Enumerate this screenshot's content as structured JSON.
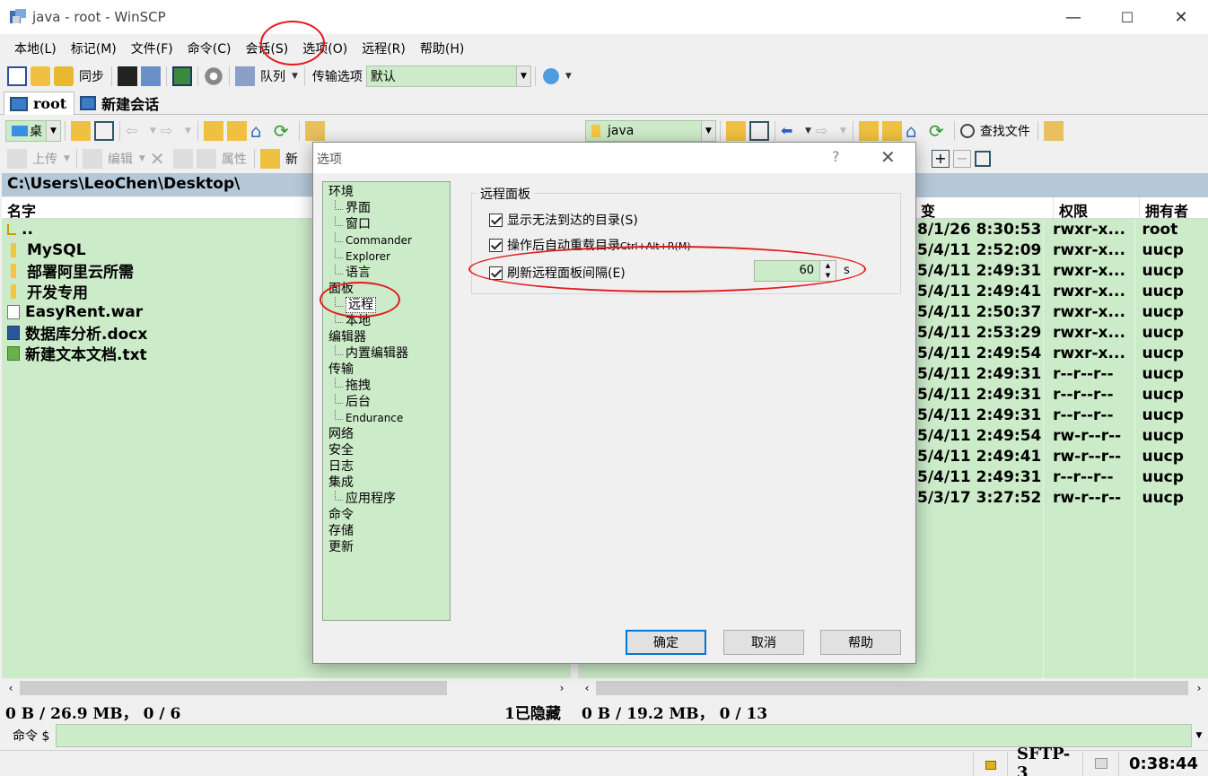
{
  "window": {
    "title": "java - root - WinSCP",
    "controls": {
      "minimize": "—",
      "maximize": "☐",
      "close": "✕"
    }
  },
  "menu": [
    "本地(L)",
    "标记(M)",
    "文件(F)",
    "命令(C)",
    "会话(S)",
    "选项(O)",
    "远程(R)",
    "帮助(H)"
  ],
  "toolbar_main": {
    "sync_label": "同步",
    "queue_label": "队列",
    "transfer_options_label": "传输选项",
    "transfer_options_value": "默认"
  },
  "tabs": [
    {
      "label": "root",
      "icon": "monitor-icon"
    },
    {
      "label": "新建会话",
      "icon": "new-session-icon"
    }
  ],
  "left_panel": {
    "drive_label": "桌",
    "actions": {
      "upload": "上传",
      "edit": "编辑",
      "properties": "属性",
      "new": "新"
    },
    "path": "C:\\Users\\LeoChen\\Desktop\\",
    "column_name": "名字",
    "files": [
      {
        "name": "..",
        "type": "up"
      },
      {
        "name": "MySQL",
        "type": "folder"
      },
      {
        "name": "部署阿里云所需",
        "type": "folder"
      },
      {
        "name": "开发专用",
        "type": "folder"
      },
      {
        "name": "EasyRent.war",
        "type": "file"
      },
      {
        "name": "数据库分析.docx",
        "type": "word"
      },
      {
        "name": "新建文本文档.txt",
        "type": "text"
      }
    ],
    "status": "0 B / 26.9 MB， 0 / 6",
    "hidden": "1已隐藏"
  },
  "right_panel": {
    "path_combo": "java",
    "find_files": "查找文件",
    "columns": {
      "changed": "变",
      "rights": "权限",
      "owner": "拥有者"
    },
    "rows": [
      {
        "changed": "8/1/26 8:30:53",
        "rights": "rwxr-x...",
        "owner": "root"
      },
      {
        "changed": "5/4/11 2:52:09",
        "rights": "rwxr-x...",
        "owner": "uucp"
      },
      {
        "changed": "5/4/11 2:49:31",
        "rights": "rwxr-x...",
        "owner": "uucp"
      },
      {
        "changed": "5/4/11 2:49:41",
        "rights": "rwxr-x...",
        "owner": "uucp"
      },
      {
        "changed": "5/4/11 2:50:37",
        "rights": "rwxr-x...",
        "owner": "uucp"
      },
      {
        "changed": "5/4/11 2:53:29",
        "rights": "rwxr-x...",
        "owner": "uucp"
      },
      {
        "changed": "5/4/11 2:49:54",
        "rights": "rwxr-x...",
        "owner": "uucp"
      },
      {
        "changed": "5/4/11 2:49:31",
        "rights": "r--r--r--",
        "owner": "uucp"
      },
      {
        "changed": "5/4/11 2:49:31",
        "rights": "r--r--r--",
        "owner": "uucp"
      },
      {
        "changed": "5/4/11 2:49:31",
        "rights": "r--r--r--",
        "owner": "uucp"
      },
      {
        "changed": "5/4/11 2:49:54",
        "rights": "rw-r--r--",
        "owner": "uucp"
      },
      {
        "changed": "5/4/11 2:49:41",
        "rights": "rw-r--r--",
        "owner": "uucp"
      },
      {
        "changed": "5/4/11 2:49:31",
        "rights": "r--r--r--",
        "owner": "uucp"
      },
      {
        "changed": "5/3/17 3:27:52",
        "rights": "rw-r--r--",
        "owner": "uucp"
      }
    ],
    "status": "0 B / 19.2 MB， 0 / 13"
  },
  "command_line": {
    "label": "命令 $",
    "value": ""
  },
  "status_bar": {
    "protocol": "SFTP-3",
    "time": "0:38:44"
  },
  "dialog": {
    "title": "选项",
    "help_glyph": "?",
    "close_glyph": "✕",
    "tree": [
      {
        "label": "环境",
        "level": 0
      },
      {
        "label": "界面",
        "level": 1
      },
      {
        "label": "窗口",
        "level": 1
      },
      {
        "label": "Commander",
        "level": 1,
        "small": true
      },
      {
        "label": "Explorer",
        "level": 1,
        "small": true
      },
      {
        "label": "语言",
        "level": 1
      },
      {
        "label": "面板",
        "level": 0
      },
      {
        "label": "远程",
        "level": 1,
        "selected": true
      },
      {
        "label": "本地",
        "level": 1
      },
      {
        "label": "编辑器",
        "level": 0
      },
      {
        "label": "内置编辑器",
        "level": 1
      },
      {
        "label": "传输",
        "level": 0
      },
      {
        "label": "拖拽",
        "level": 1
      },
      {
        "label": "后台",
        "level": 1
      },
      {
        "label": "Endurance",
        "level": 1,
        "small": true
      },
      {
        "label": "网络",
        "level": 0
      },
      {
        "label": "安全",
        "level": 0
      },
      {
        "label": "日志",
        "level": 0
      },
      {
        "label": "集成",
        "level": 0
      },
      {
        "label": "应用程序",
        "level": 1
      },
      {
        "label": "命令",
        "level": 0
      },
      {
        "label": "存储",
        "level": 0
      },
      {
        "label": "更新",
        "level": 0
      }
    ],
    "group_title": "远程面板",
    "options": {
      "show_inaccessible": "显示无法到达的目录(S)",
      "auto_reload": "操作后自动重载目录",
      "auto_reload_shortcut": "Ctrl+Alt+R(M)",
      "refresh_interval": "刷新远程面板间隔(E)"
    },
    "interval_value": "60",
    "interval_unit": "s",
    "buttons": {
      "ok": "确定",
      "cancel": "取消",
      "help": "帮助"
    }
  },
  "colors": {
    "panel_bg": "#ccebc9",
    "path_bg": "#b4c8d8",
    "annotation": "#e31b1b",
    "accent": "#0078d7"
  }
}
